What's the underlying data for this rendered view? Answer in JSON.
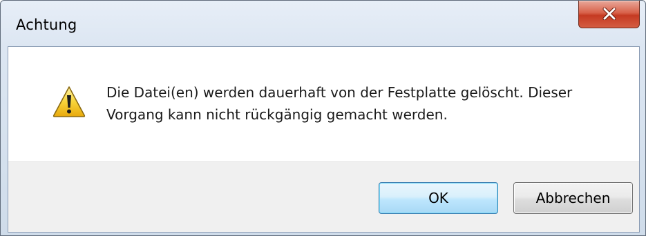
{
  "window": {
    "title": "Achtung"
  },
  "dialog": {
    "message_line1": "Die Datei(en) werden dauerhaft von der Festplatte gelöscht. Dieser",
    "message_line2": "Vorgang kann nicht rückgängig gemacht werden.",
    "icon": "warning-icon"
  },
  "buttons": {
    "ok_label": "OK",
    "cancel_label": "Abbrechen"
  },
  "colors": {
    "close_button": "#c53a22",
    "default_button_border": "#3c7fb1",
    "footer_background": "#f0f0f0",
    "warning_yellow": "#f5c211"
  }
}
